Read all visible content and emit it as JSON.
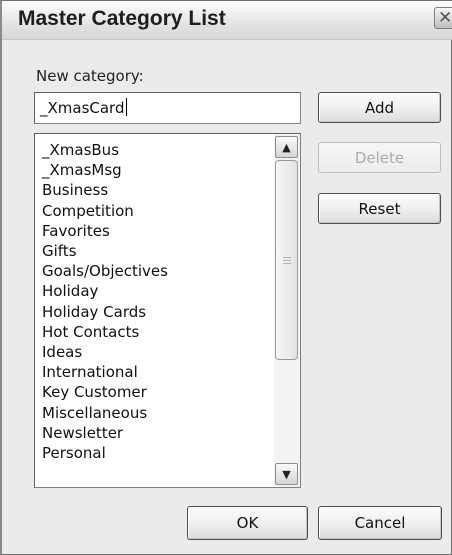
{
  "dialog": {
    "title": "Master Category List",
    "close_label": "✕"
  },
  "new_category": {
    "label": "New category:",
    "value": "_XmasCard"
  },
  "buttons": {
    "add": "Add",
    "delete": "Delete",
    "reset": "Reset",
    "ok": "OK",
    "cancel": "Cancel"
  },
  "categories": [
    "_XmasBus",
    "_XmasMsg",
    "Business",
    "Competition",
    "Favorites",
    "Gifts",
    "Goals/Objectives",
    "Holiday",
    "Holiday Cards",
    "Hot Contacts",
    "Ideas",
    "International",
    "Key Customer",
    "Miscellaneous",
    "Newsletter",
    "Personal"
  ],
  "scrollbar": {
    "up_icon": "▲",
    "down_icon": "▼"
  }
}
